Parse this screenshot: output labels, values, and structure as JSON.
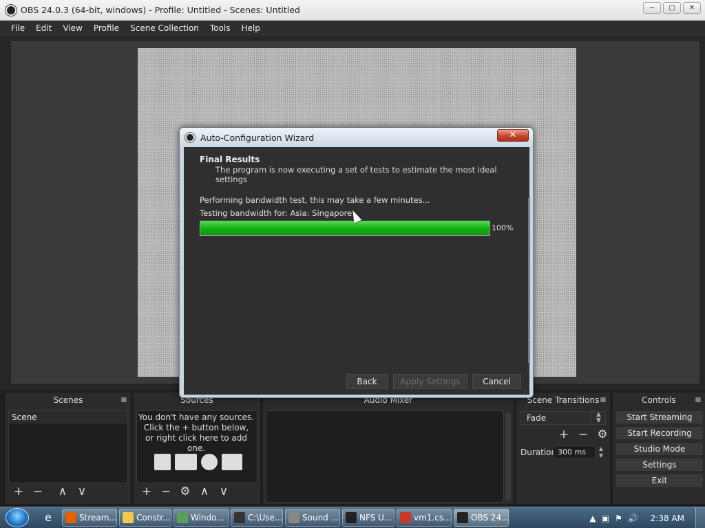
{
  "window": {
    "title": "OBS 24.0.3 (64-bit, windows) - Profile: Untitled - Scenes: Untitled",
    "minimize": "−",
    "maximize": "□",
    "close": "✕"
  },
  "menu": [
    "File",
    "Edit",
    "View",
    "Profile",
    "Scene Collection",
    "Tools",
    "Help"
  ],
  "docks": {
    "scenes": {
      "title": "Scenes",
      "items": [
        "Scene"
      ]
    },
    "sources": {
      "title": "Sources",
      "empty_lines": [
        "You don't have any sources.",
        "Click the + button below,",
        "or right click here to add one."
      ]
    },
    "mixer": {
      "title": "Audio Mixer"
    },
    "transitions": {
      "title": "Scene Transitions",
      "selected": "Fade",
      "duration_label": "Duration",
      "duration_value": "300 ms"
    },
    "controls": {
      "title": "Controls",
      "buttons": [
        "Start Streaming",
        "Start Recording",
        "Studio Mode",
        "Settings",
        "Exit"
      ]
    }
  },
  "toolbar_glyphs": {
    "add": "+",
    "remove": "−",
    "up": "∧",
    "down": "∨",
    "settings": "⚙"
  },
  "dialog": {
    "title": "Auto-Configuration Wizard",
    "close": "✕",
    "heading": "Final Results",
    "subheading": "The program is now executing a set of tests to estimate the most ideal settings",
    "status1": "Performing bandwidth test, this may take a few minutes...",
    "status2": "Testing bandwidth for: Asia: Singapore",
    "progress": 1.0,
    "progress_label": "100%",
    "buttons": {
      "back": "Back",
      "apply": "Apply Settings",
      "cancel": "Cancel"
    }
  },
  "taskbar": {
    "tasks": [
      {
        "label": "Stream...",
        "icon": "firefox-icon",
        "color": "#e66000"
      },
      {
        "label": "Constr...",
        "icon": "folder-icon",
        "color": "#f2c94c"
      },
      {
        "label": "Windo...",
        "icon": "monitor-icon",
        "color": "#5aa05a"
      },
      {
        "label": "C:\\Use...",
        "icon": "7zip-icon",
        "color": "#333333"
      },
      {
        "label": "Sound ...",
        "icon": "sound-icon",
        "color": "#888888"
      },
      {
        "label": "NFS U...",
        "icon": "nfs-icon",
        "color": "#222222"
      },
      {
        "label": "vm1.cs...",
        "icon": "file-icon",
        "color": "#c83a2a"
      },
      {
        "label": "OBS 24...",
        "icon": "obs-icon",
        "color": "#222222"
      }
    ],
    "clock": "2:38 AM"
  },
  "colors": {
    "progress_fill": "#12b012",
    "accent": "#c7452b"
  }
}
